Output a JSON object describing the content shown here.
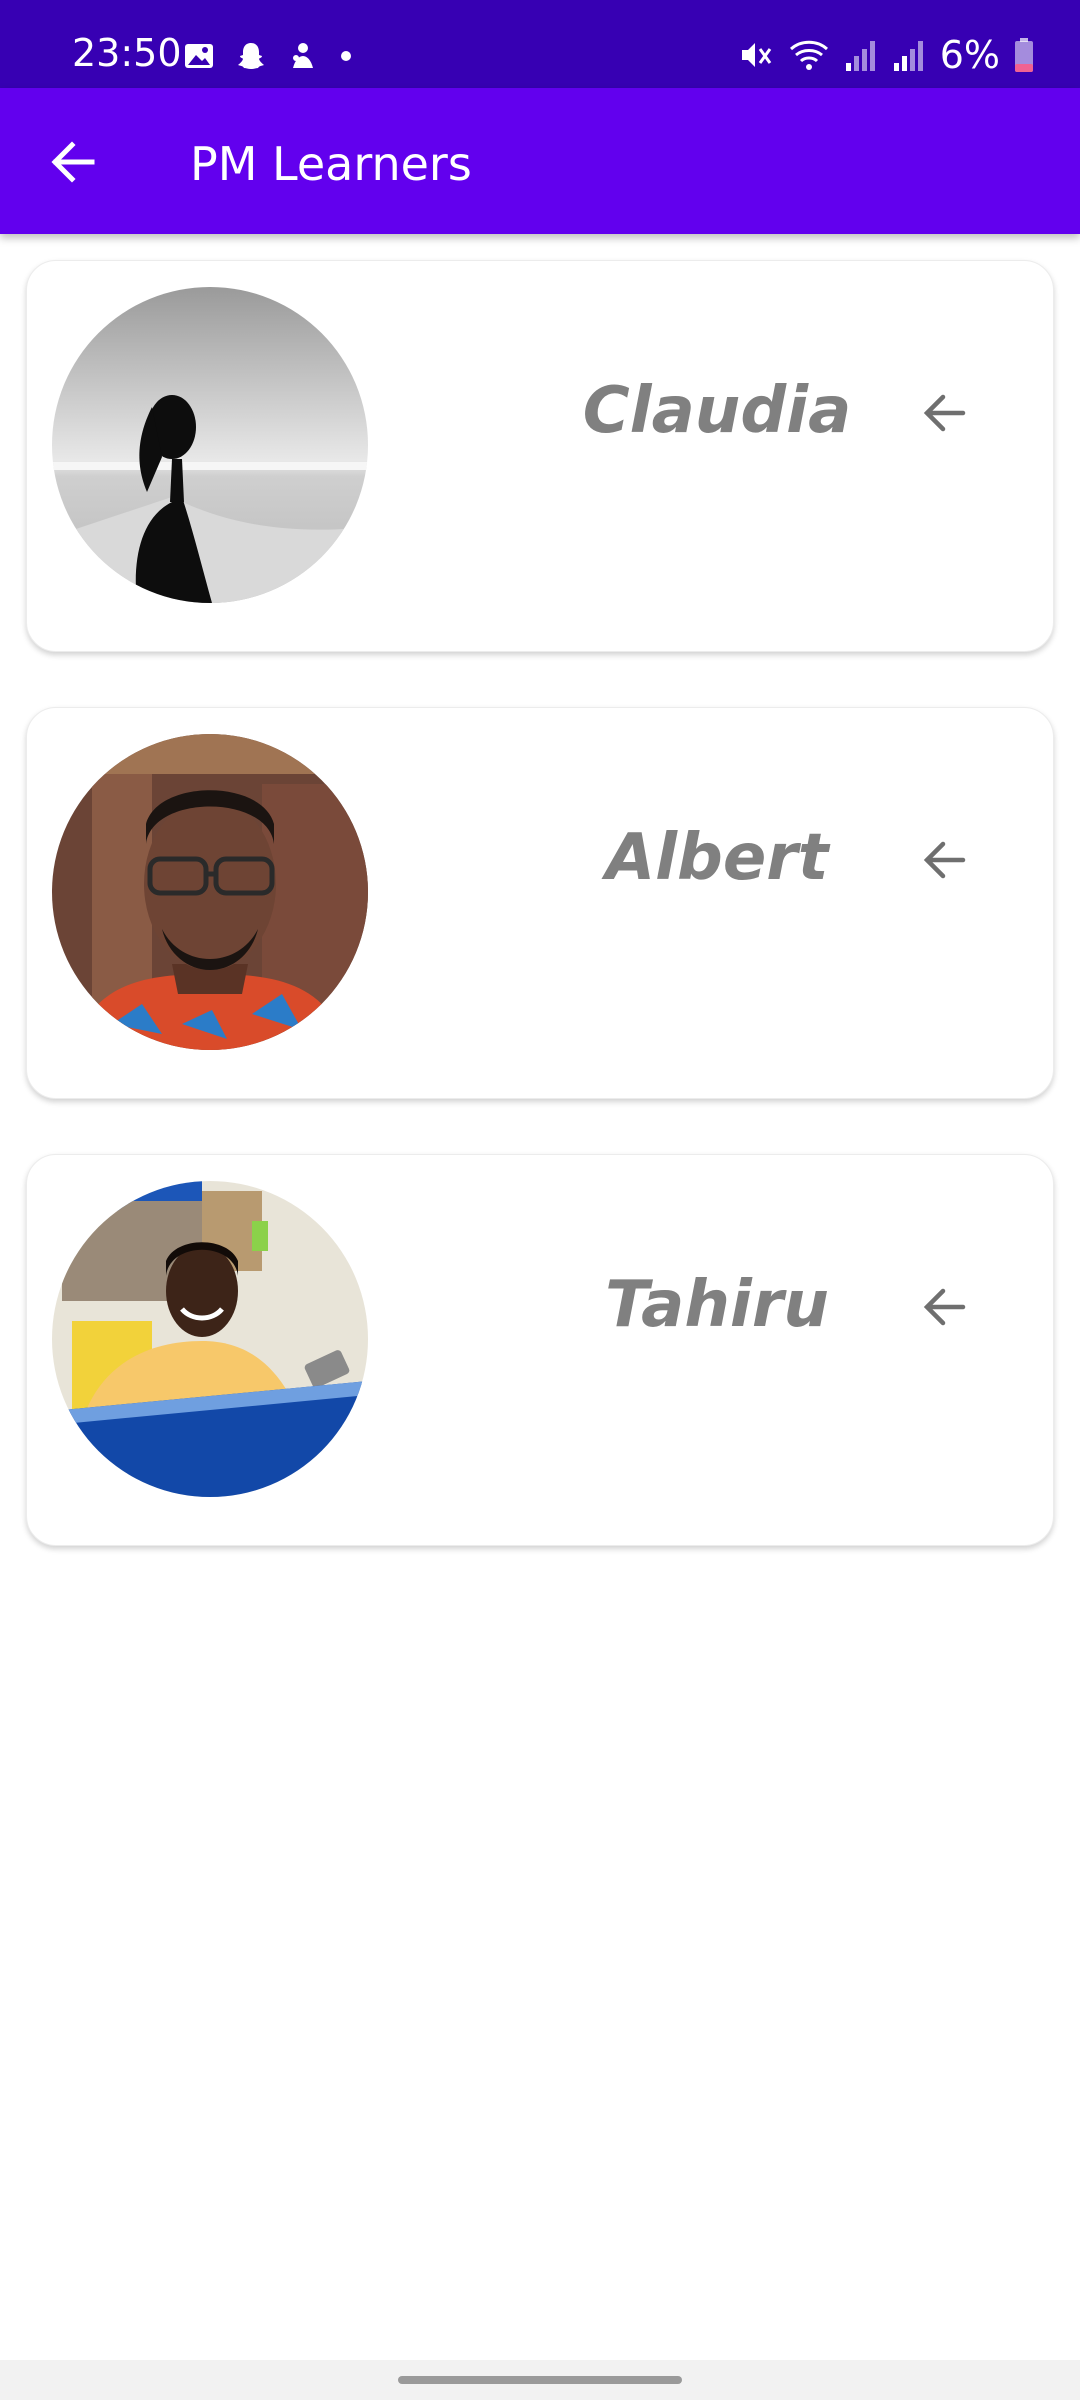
{
  "status_bar": {
    "time": "23:50",
    "battery": "6%",
    "left_icons": [
      "gallery-icon",
      "snapchat-icon",
      "notification-icon",
      "dot-icon"
    ],
    "right_icons": [
      "mute-icon",
      "wifi-icon",
      "signal-icon",
      "signal-icon",
      "battery-icon"
    ],
    "colors": {
      "background": "#3700b3",
      "battery_low": "#f06292"
    }
  },
  "app_bar": {
    "title": "PM Learners",
    "back_icon": "arrow-back-icon",
    "colors": {
      "background": "#6200ee",
      "foreground": "#ffffff"
    }
  },
  "learners": [
    {
      "name": "Claudia",
      "avatar": "photo-grayscale-silhouette-beach",
      "action_icon": "arrow-left-icon"
    },
    {
      "name": "Albert",
      "avatar": "photo-man-glasses",
      "action_icon": "arrow-left-icon"
    },
    {
      "name": "Tahiru",
      "avatar": "photo-man-yellow-shirt",
      "action_icon": "arrow-left-icon"
    }
  ],
  "colors": {
    "name_text": "#808080",
    "card_background": "#ffffff"
  }
}
